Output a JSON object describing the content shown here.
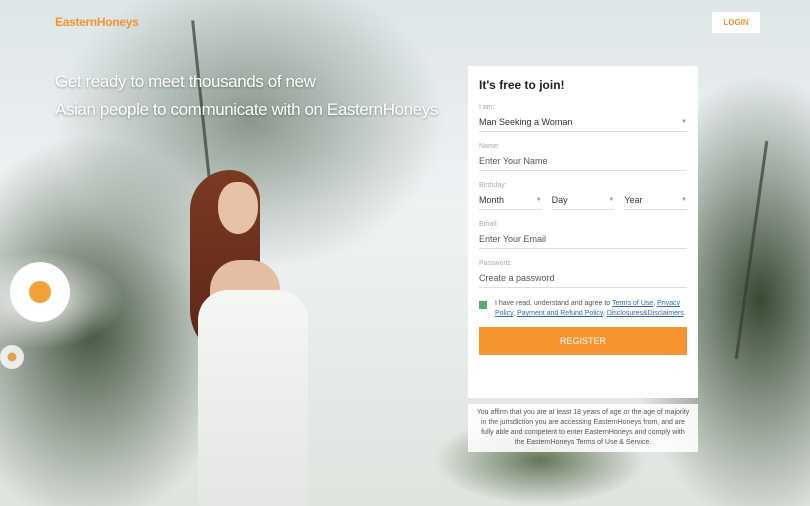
{
  "header": {
    "logo": "EasternHoneys",
    "login_label": "LOGIN"
  },
  "headline": {
    "line1": "Get ready to meet thousands of new",
    "line2": "Asian people to communicate with on EasternHoneys"
  },
  "form": {
    "title": "It's free to join!",
    "iam": {
      "label": "I am:",
      "value": "Man Seeking a Woman"
    },
    "name": {
      "label": "Name:",
      "placeholder": "Enter Your Name"
    },
    "birthday": {
      "label": "Birthday:",
      "month": "Month",
      "day": "Day",
      "year": "Year"
    },
    "email": {
      "label": "Email:",
      "placeholder": "Enter Your Email"
    },
    "password": {
      "label": "Password:",
      "placeholder": "Create a password"
    },
    "agree": {
      "prefix": "I have read, understand and agree to",
      "terms": "Terms of Use",
      "privacy": "Privacy Policy",
      "refund": "Payment and Refund Policy",
      "disclosures": "Disclosures&Disclaimers"
    },
    "register_label": "REGISTER"
  },
  "disclaimer": "You affirm that you are at least 18 years of age or the age of majority in the jurisdiction you are accessing EasternHoneys from, and are fully able and competent to enter EasternHoneys and comply with the EasternHoneys Terms of Use & Service.",
  "colors": {
    "accent": "#f7932f",
    "checkbox": "#4caf73",
    "link": "#2a6cb0"
  }
}
